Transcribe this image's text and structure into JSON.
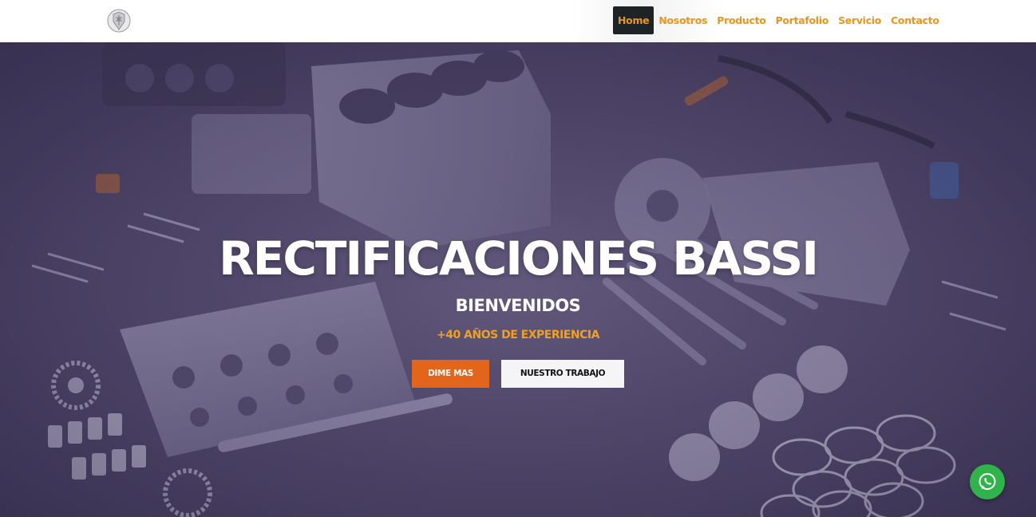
{
  "brand": {
    "logo_icon": "crest-logo-icon"
  },
  "nav": {
    "items": [
      {
        "label": "Home",
        "active": true
      },
      {
        "label": "Nosotros",
        "active": false
      },
      {
        "label": "Producto",
        "active": false
      },
      {
        "label": "Portafolio",
        "active": false
      },
      {
        "label": "Servicio",
        "active": false
      },
      {
        "label": "Contacto",
        "active": false
      }
    ]
  },
  "hero": {
    "title": "RECTIFICACIONES BASSI",
    "subtitle": "BIENVENIDOS",
    "tagline": "+40 AÑOS DE EXPERIENCIA",
    "primary_button": "DIME MAS",
    "secondary_button": "NUESTRO TRABAJO",
    "background_image": "engine-parts-exploded-view"
  },
  "whatsapp": {
    "icon": "whatsapp-icon"
  },
  "colors": {
    "accent": "#e8961c",
    "primary_button": "#e3641b",
    "active_nav_bg": "#1e2326",
    "whatsapp": "#2fb34a",
    "hero_tint": "#4b4460"
  }
}
